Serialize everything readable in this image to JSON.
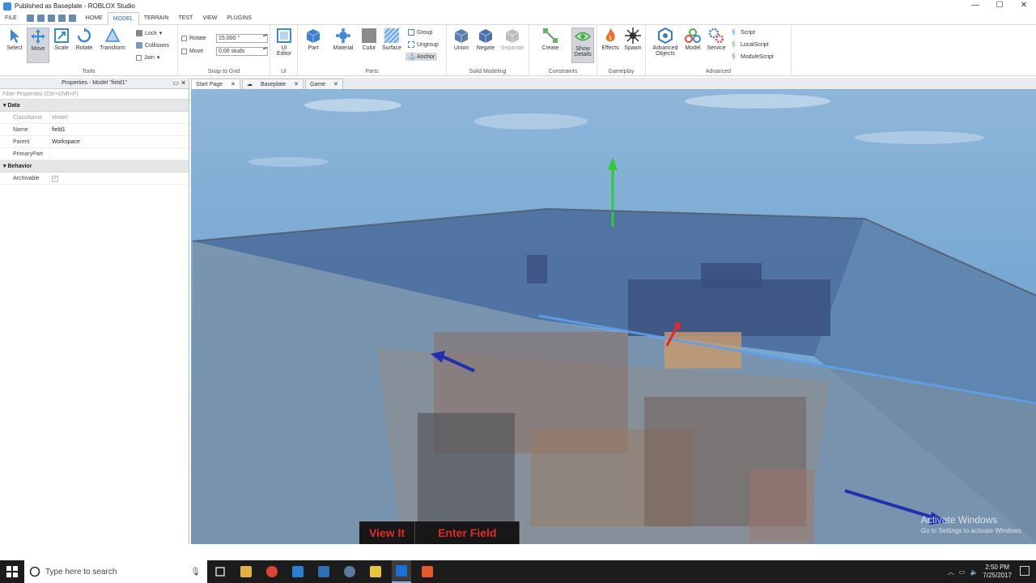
{
  "window": {
    "title": "Published as Baseplate - ROBLOX Studio",
    "controls": [
      "—",
      "☐",
      "✕"
    ]
  },
  "menu": {
    "tabs": [
      "FILE",
      "HOME",
      "MODEL",
      "TERRAIN",
      "TEST",
      "VIEW",
      "PLUGINS"
    ],
    "active": "MODEL"
  },
  "ribbon": {
    "tools": {
      "label": "Tools",
      "buttons": [
        "Select",
        "Move",
        "Scale",
        "Rotate",
        "Transform"
      ],
      "selected": "Move"
    },
    "constraints_small": {
      "lock": "Lock",
      "collisions": "Collisions",
      "join": "Join"
    },
    "snap": {
      "label": "Snap to Grid",
      "rotate_label": "Rotate",
      "rotate_value": "15.000 °",
      "move_label": "Move",
      "move_value": "0.00 studs"
    },
    "ui": {
      "label": "UI",
      "button": "UI Editor"
    },
    "parts": {
      "label": "Parts",
      "buttons": [
        "Part",
        "Material",
        "Color",
        "Surface"
      ],
      "group": "Group",
      "ungroup": "Ungroup",
      "anchor": "Anchor"
    },
    "solid": {
      "label": "Solid Modeling",
      "buttons": [
        "Union",
        "Negate",
        "Separate"
      ]
    },
    "constraints": {
      "label": "Constraints",
      "create": "Create",
      "show": "Show Details"
    },
    "gameplay": {
      "label": "Gameplay",
      "buttons": [
        "Effects",
        "Spawn"
      ]
    },
    "advanced": {
      "label": "Advanced",
      "buttons": [
        "Advanced Objects",
        "Model",
        "Service"
      ],
      "scripts": [
        "Script",
        "LocalScript",
        "ModuleScript"
      ]
    }
  },
  "properties": {
    "header": "Properties - Model \"field1\"",
    "filter_placeholder": "Filter Properties (Ctrl+Shift+P)",
    "sections": [
      {
        "name": "Data",
        "rows": [
          {
            "key": "ClassName",
            "value": "Model",
            "dim": true
          },
          {
            "key": "Name",
            "value": "field1"
          },
          {
            "key": "Parent",
            "value": "Workspace"
          },
          {
            "key": "PrimaryPart",
            "value": ""
          }
        ]
      },
      {
        "name": "Behavior",
        "rows": [
          {
            "key": "Archivable",
            "value": "✓"
          }
        ]
      }
    ]
  },
  "doc_tabs": [
    "Start Page",
    "Baseplate",
    "Game"
  ],
  "viewport": {
    "buttons": [
      "View It",
      "Enter Field"
    ],
    "watermark_title": "Activate Windows",
    "watermark_sub": "Go to Settings to activate Windows."
  },
  "taskbar": {
    "search_placeholder": "Type here to search",
    "time": "2:50 PM",
    "date": "7/25/2017",
    "app_colors": [
      "#e2b13c",
      "#db4437",
      "#2b7cd3",
      "#2d6fb0",
      "#5b7a99",
      "#e8c53a",
      "#1a6fd9",
      "#e05a2b"
    ]
  }
}
